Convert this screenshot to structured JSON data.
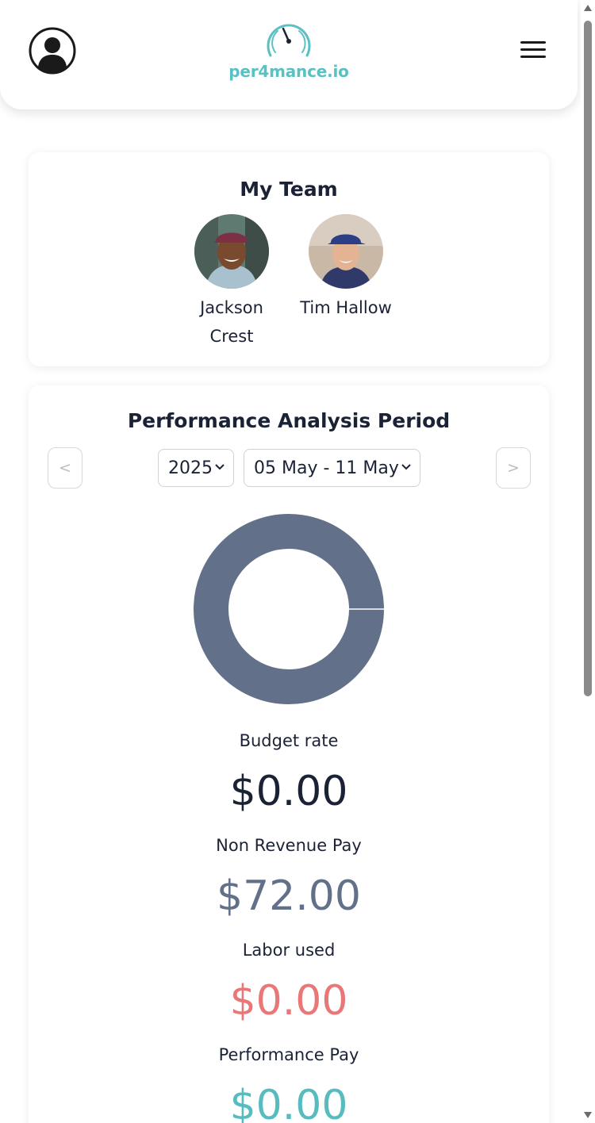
{
  "header": {
    "logo_text": "per4mance.io",
    "icons": {
      "profile": "user-circle-icon",
      "logo": "speedometer-icon",
      "menu": "hamburger-menu-icon"
    },
    "brand_color": "#5bc0c2"
  },
  "team": {
    "title": "My Team",
    "members": [
      {
        "name_line1": "Jackson",
        "name_line2": "Crest"
      },
      {
        "name_line1": "Tim Hallow",
        "name_line2": ""
      }
    ]
  },
  "performance": {
    "title": "Performance Analysis Period",
    "prev_label": "<",
    "next_label": ">",
    "year_value": "2025",
    "week_value": "05 May - 11 May",
    "donut_color": "#627189",
    "metrics": [
      {
        "label": "Budget rate",
        "value": "$0.00",
        "color": "#1b2235"
      },
      {
        "label": "Non Revenue Pay",
        "value": "$72.00",
        "color": "#627189"
      },
      {
        "label": "Labor used",
        "value": "$0.00",
        "color": "#ea7777"
      },
      {
        "label": "Performance Pay",
        "value": "$0.00",
        "color": "#56bcbf"
      }
    ]
  }
}
